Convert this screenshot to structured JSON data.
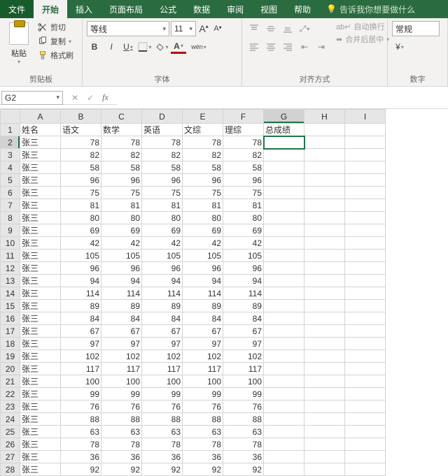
{
  "menu": {
    "file": "文件",
    "home": "开始",
    "insert": "插入",
    "layout": "页面布局",
    "formula": "公式",
    "data": "数据",
    "review": "审阅",
    "view": "视图",
    "help": "帮助",
    "tellme": "告诉我你想要做什么"
  },
  "ribbon": {
    "clipboard": {
      "paste": "粘贴",
      "cut": "剪切",
      "copy": "复制",
      "format_painter": "格式刷",
      "label": "剪贴板"
    },
    "font": {
      "name": "等线",
      "size": "11",
      "bold": "B",
      "italic": "I",
      "underline": "U",
      "wen": "wén",
      "label": "字体",
      "increase": "A",
      "decrease": "A"
    },
    "align": {
      "wrap": "自动换行",
      "merge": "合并后居中",
      "label": "对齐方式"
    },
    "number": {
      "format": "常规",
      "label": "数字"
    }
  },
  "namebox": "G2",
  "columns": [
    "A",
    "B",
    "C",
    "D",
    "E",
    "F",
    "G",
    "H",
    "I"
  ],
  "headers": [
    "姓名",
    "语文",
    "数学",
    "英语",
    "文综",
    "理综",
    "总成绩"
  ],
  "chart_data": {
    "type": "table",
    "title": "",
    "columns": [
      "姓名",
      "语文",
      "数学",
      "英语",
      "文综",
      "理综",
      "总成绩"
    ],
    "rows": [
      [
        "张三",
        78,
        78,
        78,
        78,
        78,
        null
      ],
      [
        "张三",
        82,
        82,
        82,
        82,
        82,
        null
      ],
      [
        "张三",
        58,
        58,
        58,
        58,
        58,
        null
      ],
      [
        "张三",
        96,
        96,
        96,
        96,
        96,
        null
      ],
      [
        "张三",
        75,
        75,
        75,
        75,
        75,
        null
      ],
      [
        "张三",
        81,
        81,
        81,
        81,
        81,
        null
      ],
      [
        "张三",
        80,
        80,
        80,
        80,
        80,
        null
      ],
      [
        "张三",
        69,
        69,
        69,
        69,
        69,
        null
      ],
      [
        "张三",
        42,
        42,
        42,
        42,
        42,
        null
      ],
      [
        "张三",
        105,
        105,
        105,
        105,
        105,
        null
      ],
      [
        "张三",
        96,
        96,
        96,
        96,
        96,
        null
      ],
      [
        "张三",
        94,
        94,
        94,
        94,
        94,
        null
      ],
      [
        "张三",
        114,
        114,
        114,
        114,
        114,
        null
      ],
      [
        "张三",
        89,
        89,
        89,
        89,
        89,
        null
      ],
      [
        "张三",
        84,
        84,
        84,
        84,
        84,
        null
      ],
      [
        "张三",
        67,
        67,
        67,
        67,
        67,
        null
      ],
      [
        "张三",
        97,
        97,
        97,
        97,
        97,
        null
      ],
      [
        "张三",
        102,
        102,
        102,
        102,
        102,
        null
      ],
      [
        "张三",
        117,
        117,
        117,
        117,
        117,
        null
      ],
      [
        "张三",
        100,
        100,
        100,
        100,
        100,
        null
      ],
      [
        "张三",
        99,
        99,
        99,
        99,
        99,
        null
      ],
      [
        "张三",
        76,
        76,
        76,
        76,
        76,
        null
      ],
      [
        "张三",
        88,
        88,
        88,
        88,
        88,
        null
      ],
      [
        "张三",
        63,
        63,
        63,
        63,
        63,
        null
      ],
      [
        "张三",
        78,
        78,
        78,
        78,
        78,
        null
      ],
      [
        "张三",
        36,
        36,
        36,
        36,
        36,
        null
      ],
      [
        "张三",
        92,
        92,
        92,
        92,
        92,
        null
      ]
    ]
  },
  "active_cell": {
    "row": 2,
    "col": "G"
  }
}
